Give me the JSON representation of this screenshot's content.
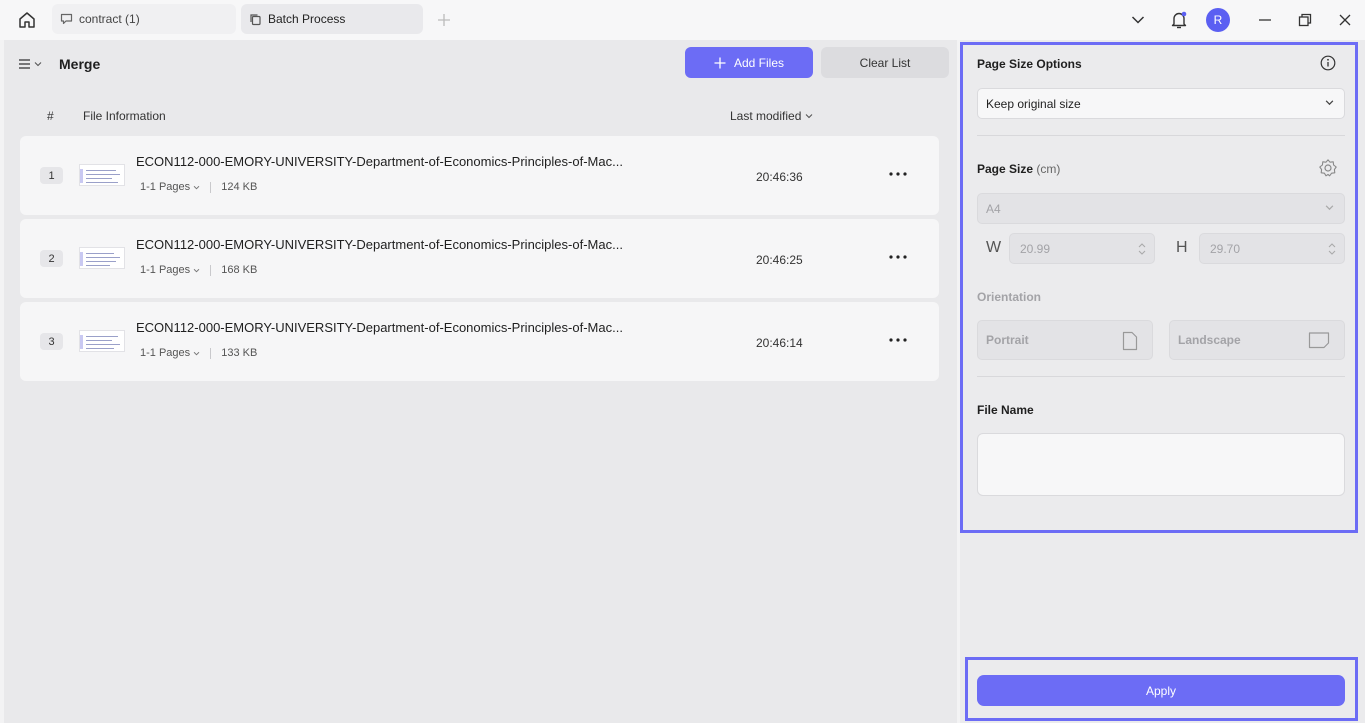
{
  "titlebar": {
    "tabs": [
      {
        "label": "contract (1)",
        "icon": "comment-icon"
      },
      {
        "label": "Batch Process",
        "icon": "copy-icon"
      }
    ],
    "avatar_initial": "R"
  },
  "main": {
    "title": "Merge",
    "add_files_label": "Add Files",
    "clear_list_label": "Clear List",
    "columns": {
      "index": "#",
      "info": "File Information",
      "modified": "Last modified"
    },
    "files": [
      {
        "index": "1",
        "name": "ECON112-000-EMORY-UNIVERSITY-Department-of-Economics-Principles-of-Mac...",
        "pages": "1-1 Pages",
        "size": "124 KB",
        "time": "20:46:36"
      },
      {
        "index": "2",
        "name": "ECON112-000-EMORY-UNIVERSITY-Department-of-Economics-Principles-of-Mac...",
        "pages": "1-1 Pages",
        "size": "168 KB",
        "time": "20:46:25"
      },
      {
        "index": "3",
        "name": "ECON112-000-EMORY-UNIVERSITY-Department-of-Economics-Principles-of-Mac...",
        "pages": "1-1 Pages",
        "size": "133 KB",
        "time": "20:46:14"
      }
    ]
  },
  "side": {
    "page_size_options_label": "Page Size Options",
    "page_size_option_value": "Keep original size",
    "page_size_label": "Page Size",
    "page_size_unit": "(cm)",
    "paper_value": "A4",
    "width_label": "W",
    "width_value": "20.99",
    "height_label": "H",
    "height_value": "29.70",
    "orientation_label": "Orientation",
    "portrait_label": "Portrait",
    "landscape_label": "Landscape",
    "file_name_label": "File Name",
    "file_name_value": "",
    "apply_label": "Apply"
  },
  "colors": {
    "accent": "#6c6cf5",
    "avatar": "#5b5ff2"
  }
}
